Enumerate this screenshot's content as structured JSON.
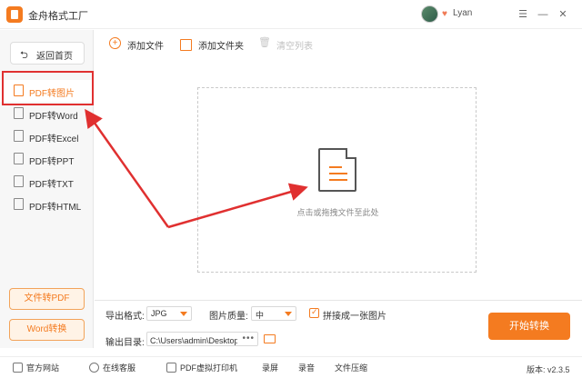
{
  "app": {
    "title": "金舟格式工厂",
    "username": "Lyan",
    "window_controls": [
      "menu-icon",
      "minimize-icon",
      "close-icon"
    ]
  },
  "sidebar": {
    "back_label": "返回首页",
    "items": [
      {
        "label": "PDF转图片",
        "icon": "image-icon",
        "active": true
      },
      {
        "label": "PDF转Word",
        "icon": "word-icon",
        "active": false
      },
      {
        "label": "PDF转Excel",
        "icon": "excel-icon",
        "active": false
      },
      {
        "label": "PDF转PPT",
        "icon": "ppt-icon",
        "active": false
      },
      {
        "label": "PDF转TXT",
        "icon": "txt-icon",
        "active": false
      },
      {
        "label": "PDF转HTML",
        "icon": "html-icon",
        "active": false
      }
    ],
    "bottom_buttons": [
      "文件转PDF",
      "Word转换"
    ]
  },
  "toolbar": {
    "add_file": "添加文件",
    "add_folder": "添加文件夹",
    "clear_list": "清空列表"
  },
  "dropzone": {
    "hint": "点击或拖拽文件至此处"
  },
  "options": {
    "export_format_label": "导出格式:",
    "export_format_value": "JPG",
    "quality_label": "图片质量:",
    "quality_value": "中",
    "merge_label": "拼接成一张图片",
    "merge_checked": true,
    "output_label": "输出目录:",
    "output_path": "C:\\Users\\admin\\Desktop\\金",
    "start_button": "开始转换"
  },
  "statusbar": {
    "items": [
      "官方网站",
      "在线客服",
      "PDF虚拟打印机",
      "录屏",
      "录音",
      "文件压缩"
    ],
    "version": "版本: v2.3.5"
  },
  "colors": {
    "accent": "#f47b20",
    "annotation": "#e03030"
  }
}
